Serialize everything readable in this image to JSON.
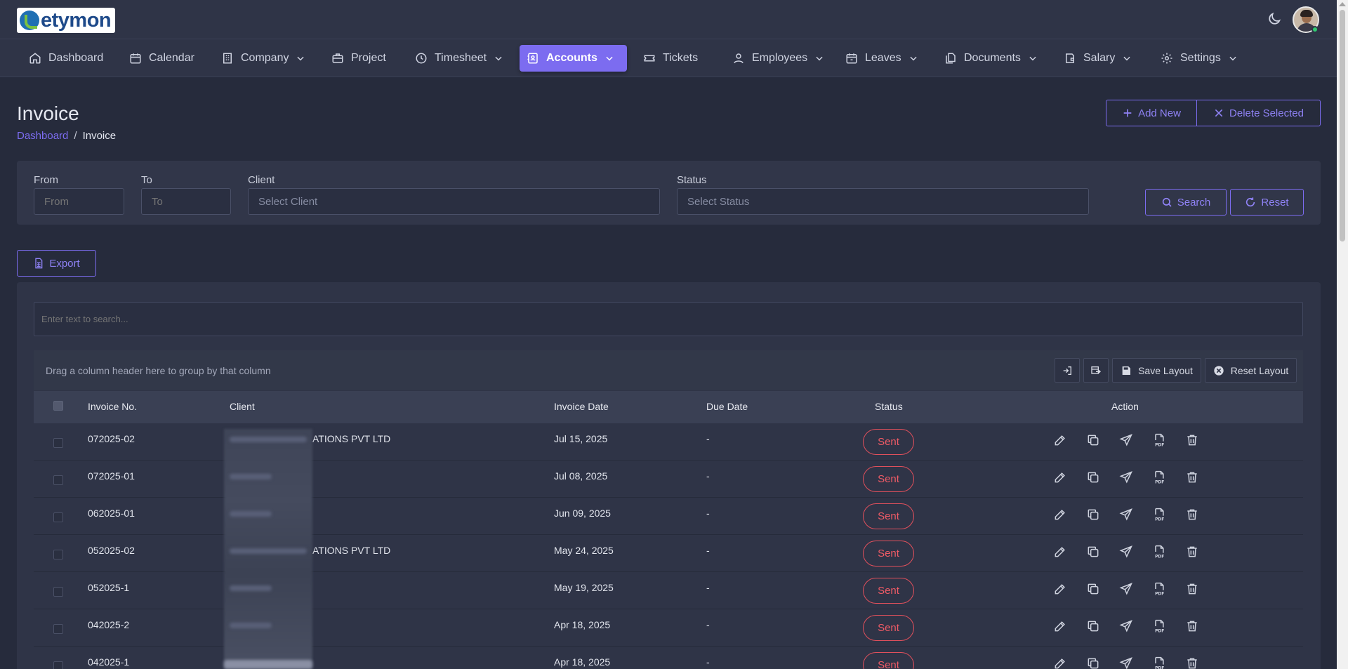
{
  "brand": {
    "name": "etymon"
  },
  "nav": [
    {
      "label": "Dashboard",
      "icon": "home-icon"
    },
    {
      "label": "Calendar",
      "icon": "calendar-icon"
    },
    {
      "label": "Company",
      "icon": "building-icon",
      "dropdown": true
    },
    {
      "label": "Project",
      "icon": "briefcase-icon"
    },
    {
      "label": "Timesheet",
      "icon": "clock-icon",
      "dropdown": true
    },
    {
      "label": "Accounts",
      "icon": "accounts-icon",
      "dropdown": true,
      "active": true
    },
    {
      "label": "Tickets",
      "icon": "ticket-icon"
    },
    {
      "label": "Employees",
      "icon": "user-icon",
      "dropdown": true
    },
    {
      "label": "Leaves",
      "icon": "calendar-icon",
      "dropdown": true
    },
    {
      "label": "Documents",
      "icon": "documents-icon",
      "dropdown": true
    },
    {
      "label": "Salary",
      "icon": "wallet-icon",
      "dropdown": true
    },
    {
      "label": "Settings",
      "icon": "gear-icon",
      "dropdown": true
    }
  ],
  "page": {
    "title": "Invoice",
    "breadcrumb": {
      "home": "Dashboard",
      "separator": "/",
      "current": "Invoice"
    },
    "add_new_label": "Add New",
    "delete_selected_label": "Delete Selected"
  },
  "filters": {
    "from": {
      "label": "From",
      "placeholder": "From",
      "value": ""
    },
    "to": {
      "label": "To",
      "placeholder": "To",
      "value": ""
    },
    "client": {
      "label": "Client",
      "placeholder": "Select Client",
      "value": ""
    },
    "status": {
      "label": "Status",
      "placeholder": "Select Status",
      "value": ""
    },
    "search_label": "Search",
    "reset_label": "Reset"
  },
  "export_label": "Export",
  "grid": {
    "search_placeholder": "Enter text to search...",
    "group_hint": "Drag a column header here to group by that column",
    "save_layout_label": "Save Layout",
    "reset_layout_label": "Reset Layout",
    "columns": {
      "invoice_no": "Invoice No.",
      "client": "Client",
      "invoice_date": "Invoice Date",
      "due_date": "Due Date",
      "status": "Status",
      "action": "Action"
    },
    "rows": [
      {
        "invoice_no": "072025-02",
        "client": "ATIONS PVT LTD",
        "invoice_date": "Jul 15, 2025",
        "due_date": "-",
        "status": "Sent"
      },
      {
        "invoice_no": "072025-01",
        "client": "",
        "invoice_date": "Jul 08, 2025",
        "due_date": "-",
        "status": "Sent"
      },
      {
        "invoice_no": "062025-01",
        "client": "",
        "invoice_date": "Jun 09, 2025",
        "due_date": "-",
        "status": "Sent"
      },
      {
        "invoice_no": "052025-02",
        "client": "ATIONS PVT LTD",
        "invoice_date": "May 24, 2025",
        "due_date": "-",
        "status": "Sent"
      },
      {
        "invoice_no": "052025-1",
        "client": "",
        "invoice_date": "May 19, 2025",
        "due_date": "-",
        "status": "Sent"
      },
      {
        "invoice_no": "042025-2",
        "client": "",
        "invoice_date": "Apr 18, 2025",
        "due_date": "-",
        "status": "Sent"
      },
      {
        "invoice_no": "042025-1",
        "client": "",
        "invoice_date": "Apr 18, 2025",
        "due_date": "-",
        "status": "Sent"
      }
    ],
    "row_actions": [
      "edit-icon",
      "copy-icon",
      "send-icon",
      "pdf-icon",
      "trash-icon"
    ]
  },
  "colors": {
    "accent": "#7c6cf0",
    "status_sent": "#ef5b66",
    "background": "#262b3c",
    "panel": "#2f3447"
  }
}
